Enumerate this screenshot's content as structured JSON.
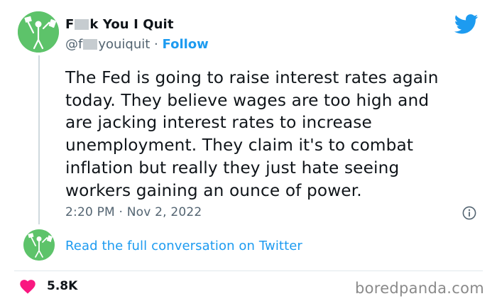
{
  "author": {
    "name_prefix": "F",
    "name_suffix": "k You I Quit",
    "handle_prefix": "@f",
    "handle_suffix": "youiquit",
    "separator": "·",
    "follow_label": "Follow"
  },
  "tweet": {
    "lines": [
      "The Fed is going to raise interest rates again",
      "today. They believe wages are too high and",
      "are jacking interest rates to increase",
      "unemployment. They claim it's to combat",
      "inflation but really they just hate seeing",
      "workers gaining an ounce of power."
    ],
    "timestamp": "2:20 PM · Nov 2, 2022"
  },
  "conversation_link": "Read the full conversation on Twitter",
  "likes": "5.8K",
  "watermark": "boredpanda.com",
  "colors": {
    "accent": "#1d9bf0",
    "avatar_bg": "#5dc36a",
    "heart": "#f91880"
  },
  "icons": [
    "twitter-bird-icon",
    "info-icon",
    "heart-icon"
  ]
}
